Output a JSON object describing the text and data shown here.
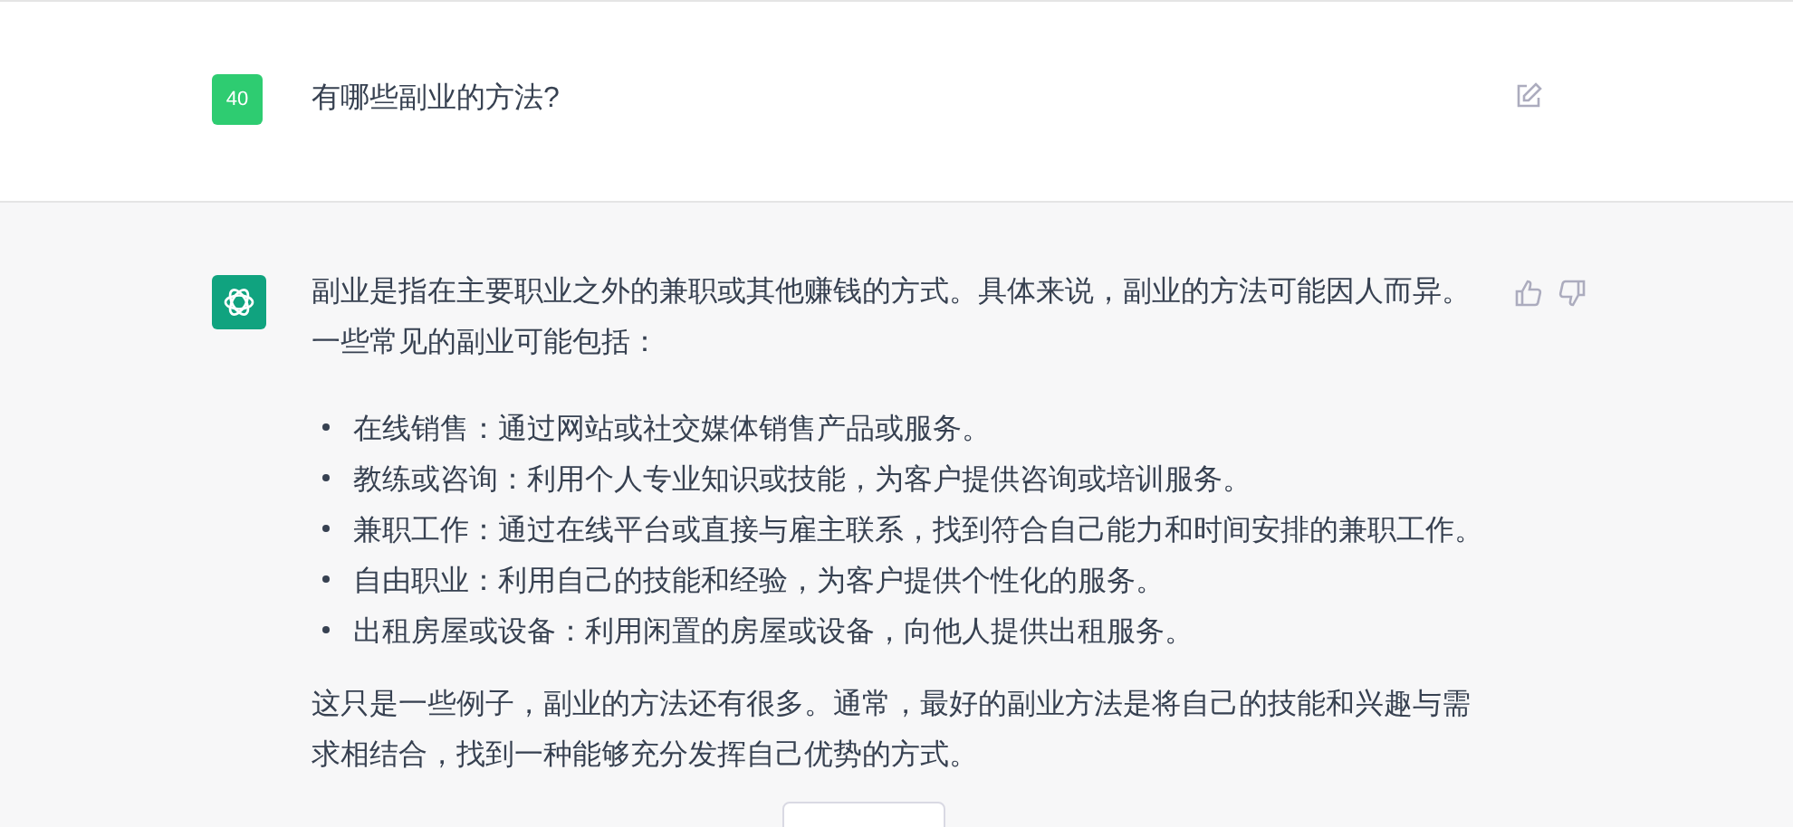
{
  "user_message": {
    "avatar": "40",
    "text": "有哪些副业的方法?"
  },
  "assistant_message": {
    "intro": "副业是指在主要职业之外的兼职或其他赚钱的方式。具体来说，副业的方法可能因人而异。一些常见的副业可能包括：",
    "bullets": [
      "在线销售：通过网站或社交媒体销售产品或服务。",
      "教练或咨询：利用个人专业知识或技能，为客户提供咨询或培训服务。",
      "兼职工作：通过在线平台或直接与雇主联系，找到符合自己能力和时间安排的兼职工作。",
      "自由职业：利用自己的技能和经验，为客户提供个性化的服务。",
      "出租房屋或设备：利用闲置的房屋或设备，向他人提供出租服务。"
    ],
    "conclusion": "这只是一些例子，副业的方法还有很多。通常，最好的副业方法是将自己的技能和兴趣与需求相结合，找到一种能够充分发挥自己优势的方式。"
  }
}
